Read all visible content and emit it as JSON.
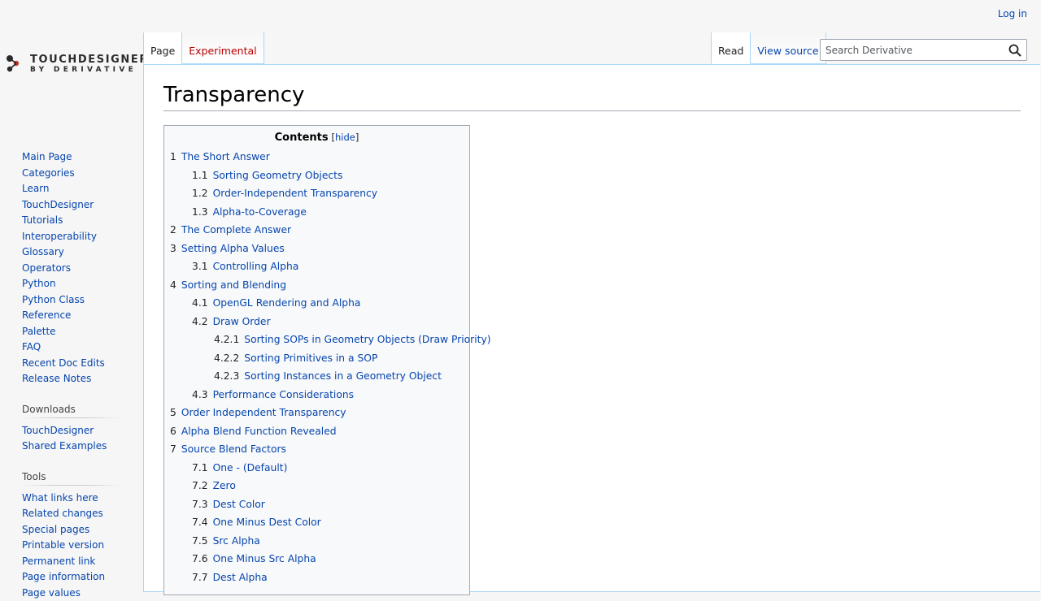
{
  "personal": {
    "login": "Log in"
  },
  "logo": {
    "line1": "TOUCHDESIGNER",
    "line2": "BY DERIVATIVE"
  },
  "left_tabs": [
    {
      "label": "Page"
    },
    {
      "label": "Experimental"
    }
  ],
  "right_tabs": [
    {
      "label": "Read"
    },
    {
      "label": "View source"
    }
  ],
  "search": {
    "placeholder": "Search Derivative"
  },
  "page": {
    "title": "Transparency"
  },
  "toc": {
    "title": "Contents",
    "hide_label": "hide",
    "entries": [
      {
        "num": "1",
        "text": "The Short Answer",
        "level": 1
      },
      {
        "num": "1.1",
        "text": "Sorting Geometry Objects",
        "level": 2
      },
      {
        "num": "1.2",
        "text": "Order-Independent Transparency",
        "level": 2
      },
      {
        "num": "1.3",
        "text": "Alpha-to-Coverage",
        "level": 2
      },
      {
        "num": "2",
        "text": "The Complete Answer",
        "level": 1
      },
      {
        "num": "3",
        "text": "Setting Alpha Values",
        "level": 1
      },
      {
        "num": "3.1",
        "text": "Controlling Alpha",
        "level": 2
      },
      {
        "num": "4",
        "text": "Sorting and Blending",
        "level": 1
      },
      {
        "num": "4.1",
        "text": "OpenGL Rendering and Alpha",
        "level": 2
      },
      {
        "num": "4.2",
        "text": "Draw Order",
        "level": 2
      },
      {
        "num": "4.2.1",
        "text": "Sorting SOPs in Geometry Objects (Draw Priority)",
        "level": 3
      },
      {
        "num": "4.2.2",
        "text": "Sorting Primitives in a SOP",
        "level": 3
      },
      {
        "num": "4.2.3",
        "text": "Sorting Instances in a Geometry Object",
        "level": 3
      },
      {
        "num": "4.3",
        "text": "Performance Considerations",
        "level": 2
      },
      {
        "num": "5",
        "text": "Order Independent Transparency",
        "level": 1
      },
      {
        "num": "6",
        "text": "Alpha Blend Function Revealed",
        "level": 1
      },
      {
        "num": "7",
        "text": "Source Blend Factors",
        "level": 1
      },
      {
        "num": "7.1",
        "text": "One - (Default)",
        "level": 2
      },
      {
        "num": "7.2",
        "text": "Zero",
        "level": 2
      },
      {
        "num": "7.3",
        "text": "Dest Color",
        "level": 2
      },
      {
        "num": "7.4",
        "text": "One Minus Dest Color",
        "level": 2
      },
      {
        "num": "7.5",
        "text": "Src Alpha",
        "level": 2
      },
      {
        "num": "7.6",
        "text": "One Minus Src Alpha",
        "level": 2
      },
      {
        "num": "7.7",
        "text": "Dest Alpha",
        "level": 2
      }
    ]
  },
  "sidebar": {
    "navigation": [
      "Main Page",
      "Categories",
      "Learn TouchDesigner",
      "Tutorials",
      "Interoperability",
      "Glossary",
      "Operators",
      "Python",
      "Python Class Reference",
      "Palette",
      "FAQ",
      "Recent Doc Edits",
      "Release Notes"
    ],
    "downloads": {
      "heading": "Downloads",
      "items": [
        "TouchDesigner",
        "Shared Examples"
      ]
    },
    "tools": {
      "heading": "Tools",
      "items": [
        "What links here",
        "Related changes",
        "Special pages",
        "Printable version",
        "Permanent link",
        "Page information",
        "Page values"
      ]
    }
  },
  "colors": {
    "link": "#0645ad",
    "new_link": "#ba0000",
    "tab_border": "#a7d7f9"
  }
}
